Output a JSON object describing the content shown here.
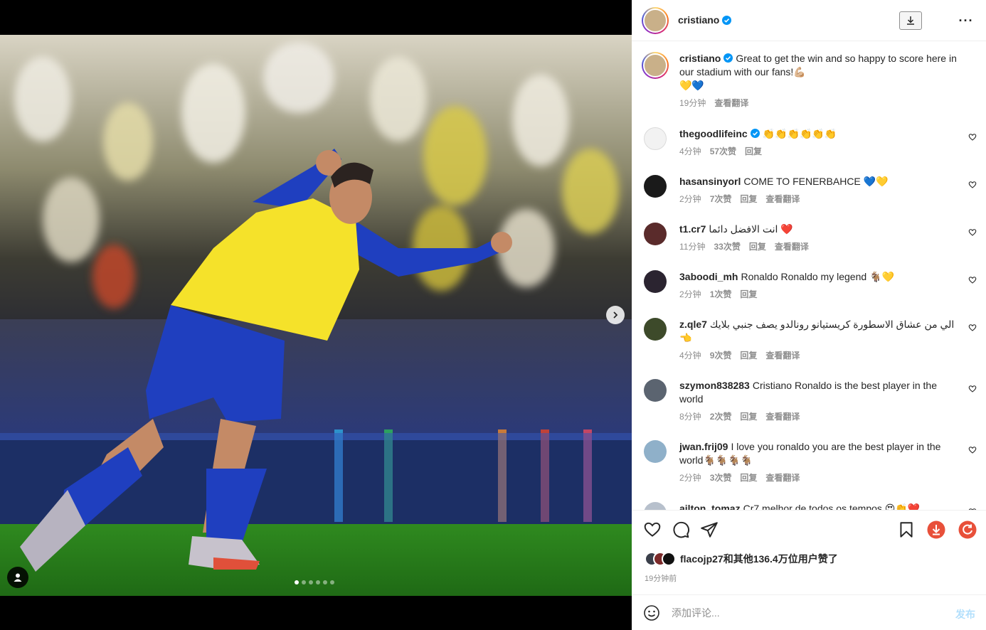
{
  "post": {
    "author": "cristiano",
    "caption": "Great to get the win and so happy to score here in our stadium with our fans!💪🏼",
    "caption_line2": "💛💙",
    "caption_time": "19分钟",
    "caption_translate": "查看翻译"
  },
  "comments": [
    {
      "user": "thegoodlifeinc",
      "text": "👏👏👏👏👏👏",
      "time": "4分钟",
      "likes": "57次赞",
      "reply": "回复",
      "translate": ""
    },
    {
      "user": "hasansinyorl",
      "text": "COME TO FENERBAHCE 💙💛",
      "time": "2分钟",
      "likes": "7次赞",
      "reply": "回复",
      "translate": "查看翻译"
    },
    {
      "user": "t1.cr7",
      "text": "انت الافضل دائما ❤️",
      "time": "11分钟",
      "likes": "33次赞",
      "reply": "回复",
      "translate": "查看翻译"
    },
    {
      "user": "3aboodi_mh",
      "text": "Ronaldo Ronaldo my legend 🐐💛",
      "time": "2分钟",
      "likes": "1次赞",
      "reply": "回复",
      "translate": ""
    },
    {
      "user": "z.qle7",
      "text": "الي من عشاق الاسطورة كريستيانو رونالدو يصف جنبي بلايك 👈",
      "time": "4分钟",
      "likes": "9次赞",
      "reply": "回复",
      "translate": "查看翻译"
    },
    {
      "user": "szymon838283",
      "text": "Cristiano Ronaldo is the best player in the world",
      "time": "8分钟",
      "likes": "2次赞",
      "reply": "回复",
      "translate": "查看翻译"
    },
    {
      "user": "jwan.frij09",
      "text": "I love you ronaldo you are the best player in the world🐐🐐🐐🐐",
      "time": "2分钟",
      "likes": "3次赞",
      "reply": "回复",
      "translate": "查看翻译"
    },
    {
      "user": "ailton_tomaz",
      "text": "Cr7 melhor de todos os tempos 😍👏❤️",
      "time": "",
      "likes": "",
      "reply": "",
      "translate": ""
    }
  ],
  "likes_summary": "flacojp27和其他136.4万位用户赞了",
  "post_time": "19分钟前",
  "composer": {
    "placeholder": "添加评论...",
    "post_label": "发布"
  },
  "colors": {
    "verified": "#0095f6",
    "jersey_yellow": "#f5e22a",
    "jersey_blue": "#1f3fbf",
    "grass": "#2f8a1f",
    "post_disabled": "#b2dffc"
  },
  "icons": [
    "download-icon",
    "more-icon",
    "heart-icon",
    "comment-icon",
    "share-icon",
    "bookmark-icon",
    "chevron-right-icon",
    "user-tag-icon",
    "emoji-icon",
    "verified-icon"
  ],
  "carousel": {
    "slides": 6,
    "active": 1
  }
}
